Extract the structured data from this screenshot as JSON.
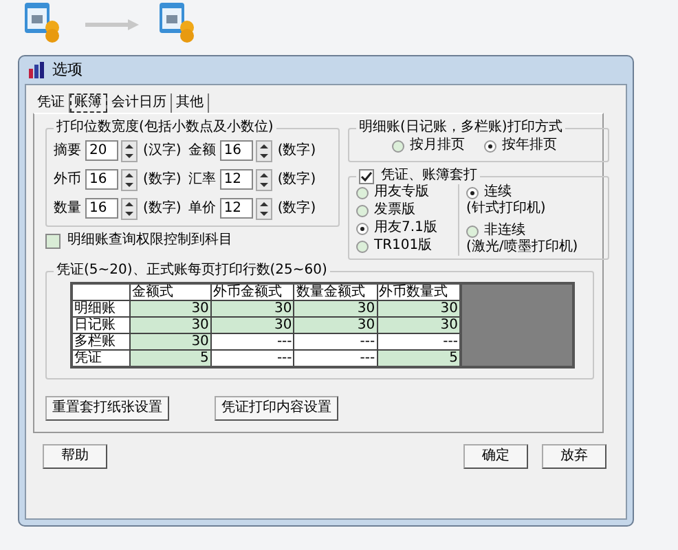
{
  "window": {
    "title": "选项"
  },
  "tabs": [
    {
      "label": "凭证",
      "selected": false
    },
    {
      "label": "账簿",
      "selected": true
    },
    {
      "label": "会计日历",
      "selected": false
    },
    {
      "label": "其他",
      "selected": false
    }
  ],
  "print_width": {
    "title": "打印位数宽度(包括小数点及小数位)",
    "rows": [
      [
        {
          "label": "摘要",
          "value": "20",
          "unit": "(汉字)"
        },
        {
          "label": "金额",
          "value": "16",
          "unit": "(数字)"
        }
      ],
      [
        {
          "label": "外币",
          "value": "16",
          "unit": "(数字)"
        },
        {
          "label": "汇率",
          "value": "12",
          "unit": "(数字)"
        }
      ],
      [
        {
          "label": "数量",
          "value": "16",
          "unit": "(数字)"
        },
        {
          "label": "单价",
          "value": "12",
          "unit": "(数字)"
        }
      ]
    ]
  },
  "subject_control": {
    "label": "明细账查询权限控制到科目",
    "checked": false
  },
  "detail_print": {
    "title": "明细账(日记账，多栏账)打印方式",
    "options": [
      {
        "label": "按月排页",
        "selected": false
      },
      {
        "label": "按年排页",
        "selected": true
      }
    ]
  },
  "overlay_print": {
    "label": "凭证、账簿套打",
    "checked": true,
    "formats": [
      {
        "label": "用友专版",
        "selected": false
      },
      {
        "label": "发票版",
        "selected": false
      },
      {
        "label": "用友7.1版",
        "selected": true
      },
      {
        "label": "TR101版",
        "selected": false
      }
    ],
    "modes": [
      {
        "label": "连续",
        "note": "(针式打印机)",
        "selected": true
      },
      {
        "label": "非连续",
        "note": "(激光/喷墨打印机)",
        "selected": false
      }
    ]
  },
  "lines_table": {
    "title": "凭证(5~20)、正式账每页打印行数(25~60)",
    "columns": [
      "金额式",
      "外币金额式",
      "数量金额式",
      "外币数量式"
    ],
    "rows": [
      {
        "label": "明细账",
        "cells": [
          {
            "value": "30",
            "enabled": true
          },
          {
            "value": "30",
            "enabled": true
          },
          {
            "value": "30",
            "enabled": true
          },
          {
            "value": "30",
            "enabled": true
          }
        ]
      },
      {
        "label": "日记账",
        "cells": [
          {
            "value": "30",
            "enabled": true
          },
          {
            "value": "30",
            "enabled": true
          },
          {
            "value": "30",
            "enabled": true
          },
          {
            "value": "30",
            "enabled": true
          }
        ]
      },
      {
        "label": "多栏账",
        "cells": [
          {
            "value": "30",
            "enabled": true
          },
          {
            "value": "---",
            "enabled": false
          },
          {
            "value": "---",
            "enabled": false
          },
          {
            "value": "---",
            "enabled": false
          }
        ]
      },
      {
        "label": "凭证",
        "cells": [
          {
            "value": "5",
            "enabled": true
          },
          {
            "value": "---",
            "enabled": false
          },
          {
            "value": "---",
            "enabled": false
          },
          {
            "value": "5",
            "enabled": true
          }
        ]
      }
    ]
  },
  "panel_buttons": [
    "重置套打纸张设置",
    "凭证打印内容设置"
  ],
  "footer": {
    "help": "帮助",
    "ok": "确定",
    "cancel": "放弃"
  }
}
